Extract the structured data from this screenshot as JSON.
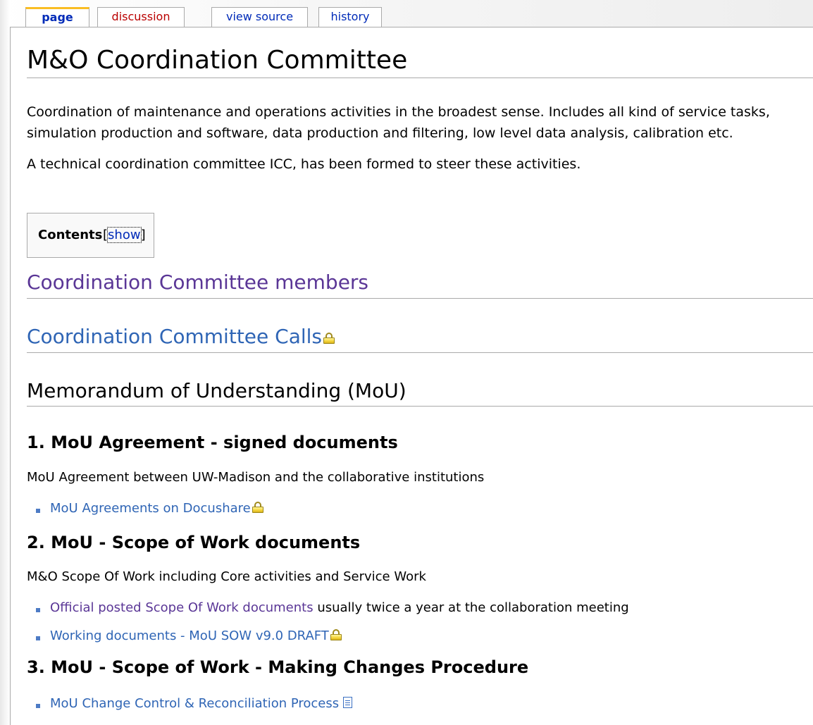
{
  "tabs": {
    "page": "page",
    "discussion": "discussion",
    "view_source": "view source",
    "history": "history"
  },
  "title": "M&O Coordination Committee",
  "intro": {
    "line1": "Coordination of maintenance and operations activities in the broadest sense. Includes all kind of service tasks,",
    "line2": "simulation production and software, data production and filtering, low level data analysis, calibration etc.",
    "line3": "A technical coordination committee ICC, has been formed to steer these activities."
  },
  "toc": {
    "title": "Contents",
    "open_bracket": "[",
    "toggle": "show",
    "close_bracket": "]"
  },
  "sections": {
    "members": "Coordination Committee members",
    "calls": "Coordination Committee Calls",
    "mou": "Memorandum of Understanding (MoU)"
  },
  "subsections": {
    "agreement": {
      "heading": "1. MoU Agreement - signed documents",
      "text": "MoU Agreement between UW-Madison and the collaborative institutions",
      "link": "MoU Agreements on Docushare"
    },
    "sow": {
      "heading": "2. MoU - Scope of Work documents",
      "text": "M&O Scope Of Work including Core activities and Service Work",
      "link1": "Official posted Scope Of Work documents",
      "link1_rest": " usually twice a year at the collaboration meeting",
      "link2": "Working documents - MoU SOW v9.0 DRAFT"
    },
    "changes": {
      "heading": "3. MoU - Scope of Work - Making Changes Procedure",
      "link": "MoU Change Control & Reconciliation Process"
    }
  },
  "icons": {
    "lock": "lock-icon",
    "document": "document-icon"
  },
  "colors": {
    "link": "#2f65b5",
    "visited_link": "#5a3696",
    "new_link": "#ba0000",
    "tab_accent": "#fabd23"
  }
}
